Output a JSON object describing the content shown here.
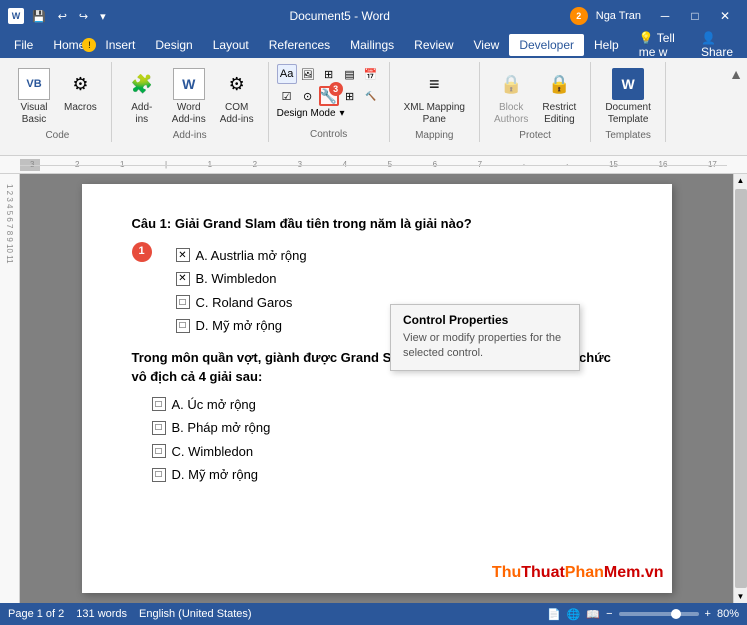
{
  "titlebar": {
    "doc_title": "Document5 - Word",
    "user_name": "Nga Tran",
    "save_icon": "💾",
    "undo_icon": "↩",
    "redo_icon": "↪",
    "customize_icon": "▾"
  },
  "menubar": {
    "items": [
      {
        "id": "file",
        "label": "File"
      },
      {
        "id": "home",
        "label": "Home"
      },
      {
        "id": "insert",
        "label": "Insert"
      },
      {
        "id": "design",
        "label": "Design"
      },
      {
        "id": "layout",
        "label": "Layout"
      },
      {
        "id": "references",
        "label": "References"
      },
      {
        "id": "mailings",
        "label": "Mailings"
      },
      {
        "id": "review",
        "label": "Review"
      },
      {
        "id": "view",
        "label": "View"
      },
      {
        "id": "developer",
        "label": "Developer",
        "active": true
      },
      {
        "id": "help",
        "label": "Help"
      }
    ]
  },
  "ribbon": {
    "groups": [
      {
        "id": "code",
        "label": "Code",
        "buttons": [
          {
            "id": "visual-basic",
            "label": "Visual\nBasic",
            "icon": "VB"
          },
          {
            "id": "macros",
            "label": "Macros",
            "icon": "⚙"
          }
        ]
      },
      {
        "id": "add-ins",
        "label": "Add-ins",
        "buttons": [
          {
            "id": "add-ins",
            "label": "Add-\nins",
            "icon": "🧩"
          },
          {
            "id": "word-add-ins",
            "label": "Word\nAdd-ins",
            "icon": "W"
          },
          {
            "id": "com-add-ins",
            "label": "COM\nAdd-ins",
            "icon": "⚙"
          }
        ]
      },
      {
        "id": "controls",
        "label": "Controls",
        "buttons": []
      },
      {
        "id": "mapping",
        "label": "Mapping",
        "buttons": [
          {
            "id": "xml-mapping",
            "label": "XML Mapping\nPane",
            "icon": "≡"
          }
        ]
      },
      {
        "id": "protect",
        "label": "Protect",
        "buttons": [
          {
            "id": "block-authors",
            "label": "Block\nAuthors",
            "icon": "🔒"
          },
          {
            "id": "restrict-editing",
            "label": "Restrict\nEditing",
            "icon": "🔒"
          }
        ]
      },
      {
        "id": "templates",
        "label": "Templates",
        "buttons": [
          {
            "id": "document-template",
            "label": "Document\nTemplate",
            "icon": "W"
          }
        ]
      }
    ]
  },
  "tooltip": {
    "title": "Control Properties",
    "body": "View or modify properties for the selected control."
  },
  "document": {
    "question": "Câu 1: Giải Grand Slam đầu tiên trong năm là giải nào?",
    "answers": [
      {
        "id": "a",
        "text": "A. Austrlia mở rộng",
        "checked": true
      },
      {
        "id": "b",
        "text": "B. Wimbledon",
        "checked": true
      },
      {
        "id": "c",
        "text": "C. Roland Garos",
        "checked": false
      },
      {
        "id": "d",
        "text": "D. Mỹ mở rộng",
        "checked": false
      }
    ],
    "paragraph": "Trong môn quần vợt, giành được Grand Slam nghĩa là trong 1 năm đoạt chức vô địch cả 4 giải sau:",
    "answers2": [
      {
        "id": "a2",
        "text": "A. Úc mở rộng",
        "checked": false
      },
      {
        "id": "b2",
        "text": "B. Pháp mở rộng",
        "checked": false
      },
      {
        "id": "c2",
        "text": "C. Wimbledon",
        "checked": false
      },
      {
        "id": "d2",
        "text": "D. Mỹ mở rộng",
        "checked": false
      }
    ]
  },
  "statusbar": {
    "page_info": "Page 1 of 2",
    "word_count": "131 words",
    "language": "English (United States)",
    "zoom": "80%"
  },
  "watermark": {
    "text": "ThuThuatPhanMem.vn"
  },
  "steps": {
    "step1": "1",
    "step2": "2",
    "step3": "3"
  }
}
